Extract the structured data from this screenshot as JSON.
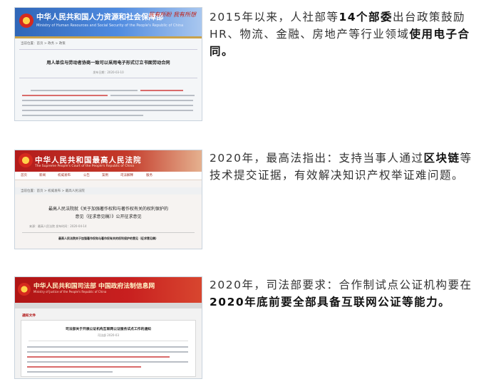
{
  "items": [
    {
      "thumb": {
        "site_name": "中华人民共和国人力资源和社会保障部",
        "site_en": "Ministry of Human Resources and Social Security of the People's Republic of China",
        "slogan": "民有所盼 我有所想",
        "breadcrumb": "当前位置：首页 > 政务 > 政策",
        "doc_title": "用人单位与劳动者协商一致可以采用电子形式订立书面劳动合同",
        "meta": "发布日期：2020-03-10"
      },
      "caption_parts": [
        {
          "text": "2015年以来，人社部等",
          "bold": false
        },
        {
          "text": "14个部委",
          "bold": true
        },
        {
          "text": "出台政策鼓励HR、物流、金融、房地产等行业领域",
          "bold": false
        },
        {
          "text": "使用电子合同",
          "bold": true
        },
        {
          "text": "。",
          "bold": true
        }
      ]
    },
    {
      "thumb": {
        "site_name": "中华人民共和国最高人民法院",
        "site_en": "The Supreme People's Court of the People's Republic of China",
        "nav": [
          "首页",
          "新闻",
          "权威发布",
          "公告",
          "案例",
          "司法解释",
          "服务"
        ],
        "breadcrumb": "当前位置：首页 > 权威发布 > 最高人民法院",
        "doc_title_1": "最高人民法院就《关于加强著作权和与著作权有关的权利保护的",
        "doc_title_2": "意见（征求意见稿）》公开征求意见",
        "meta": "来源：最高人民法院    发布时间：2020-04-14",
        "footer": "最高人民法院关于加强著作权和与著作权有关的权利保护的意见（征求意见稿）"
      },
      "caption_parts": [
        {
          "text": "2020年，最高法指出：支持当事人通过",
          "bold": false
        },
        {
          "text": "区块链",
          "bold": true
        },
        {
          "text": "等技术提交证据，有效解决知识产权举证难问题。",
          "bold": false
        }
      ]
    },
    {
      "thumb": {
        "site_name": "中华人民共和国司法部 中国政府法制信息网",
        "site_en": "Ministry of Justice of the People's Republic of China",
        "red_label": "通知文件",
        "doc_title": "司法部关于开展公证机构互联网公证服务试点工作的通知",
        "meta": "司法部 2020-03"
      },
      "caption_parts": [
        {
          "text": "2020年，司法部要求：合作制试点公证机构要在",
          "bold": false
        },
        {
          "text": "2020年底前要全部具备互联网公证等能力。",
          "bold": true
        }
      ]
    }
  ]
}
